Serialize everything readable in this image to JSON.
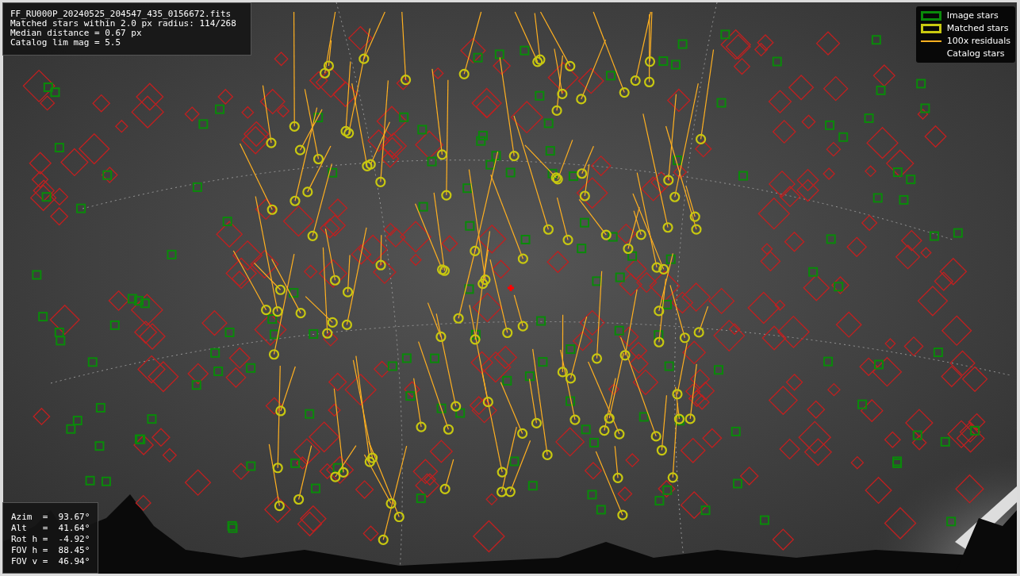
{
  "file_info": {
    "lines": [
      "FF_RU000P_20240525_204547_435_0156672.fits",
      "Matched stars within 2.0 px radius: 114/268",
      "Median distance = 0.67 px",
      "Catalog lim mag = 5.5"
    ]
  },
  "legend": {
    "items": [
      {
        "label": "Image stars",
        "kind": "box",
        "color": "#0a8a0a"
      },
      {
        "label": "Matched stars",
        "kind": "box",
        "color": "#c8c810"
      },
      {
        "label": "100x residuals",
        "kind": "line",
        "color": "#ffb020"
      },
      {
        "label": "Catalog stars",
        "kind": "blank"
      }
    ]
  },
  "pointing": {
    "lines": [
      "Azim  =  93.67°",
      "Alt   =  41.64°",
      "Rot h =  -4.92°",
      "FOV h =  88.45°",
      "FOV v =  46.94°"
    ]
  }
}
